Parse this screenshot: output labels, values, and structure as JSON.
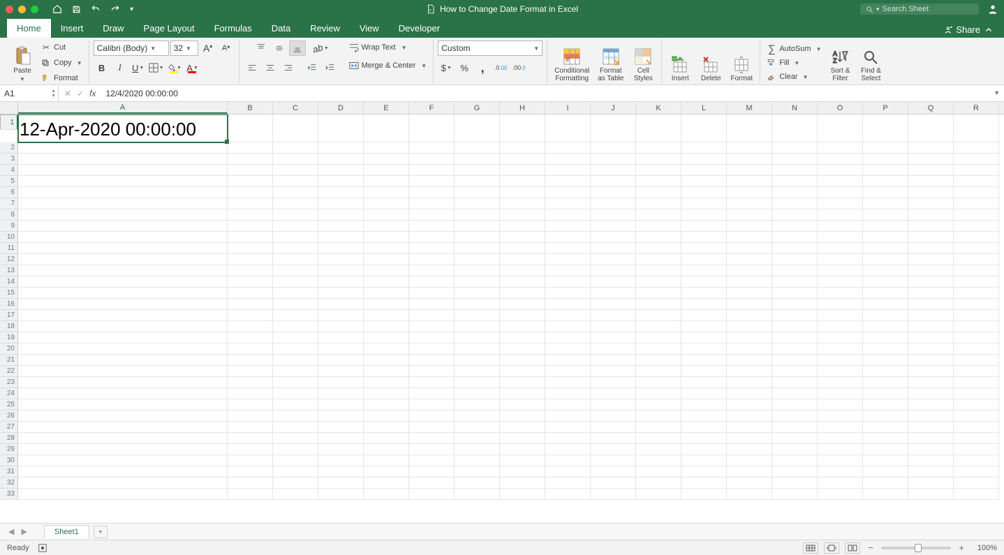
{
  "title": "How to Change Date Format in Excel",
  "search_placeholder": "Search Sheet",
  "tabs": [
    "Home",
    "Insert",
    "Draw",
    "Page Layout",
    "Formulas",
    "Data",
    "Review",
    "View",
    "Developer"
  ],
  "share_label": "Share",
  "clipboard": {
    "paste": "Paste",
    "cut": "Cut",
    "copy": "Copy",
    "format": "Format"
  },
  "font": {
    "name": "Calibri (Body)",
    "size": "32"
  },
  "alignment": {
    "wrap": "Wrap Text",
    "merge": "Merge & Center"
  },
  "number": {
    "format": "Custom"
  },
  "styles": {
    "cf": "Conditional\nFormatting",
    "fat": "Format\nas Table",
    "cs": "Cell\nStyles"
  },
  "cells": {
    "insert": "Insert",
    "delete": "Delete",
    "format": "Format"
  },
  "editing": {
    "autosum": "AutoSum",
    "fill": "Fill",
    "clear": "Clear",
    "sort": "Sort &\nFilter",
    "find": "Find &\nSelect"
  },
  "namebox": "A1",
  "formula_value": "12/4/2020  00:00:00",
  "cellA1_display": "12-Apr-2020 00:00:00",
  "columns": [
    "A",
    "B",
    "C",
    "D",
    "E",
    "F",
    "G",
    "H",
    "I",
    "J",
    "K",
    "L",
    "M",
    "N",
    "O",
    "P",
    "Q",
    "R"
  ],
  "column_widths": {
    "A": 300,
    "other": 65
  },
  "row_count": 33,
  "sheet_name": "Sheet1",
  "status_ready": "Ready",
  "zoom": "100%"
}
